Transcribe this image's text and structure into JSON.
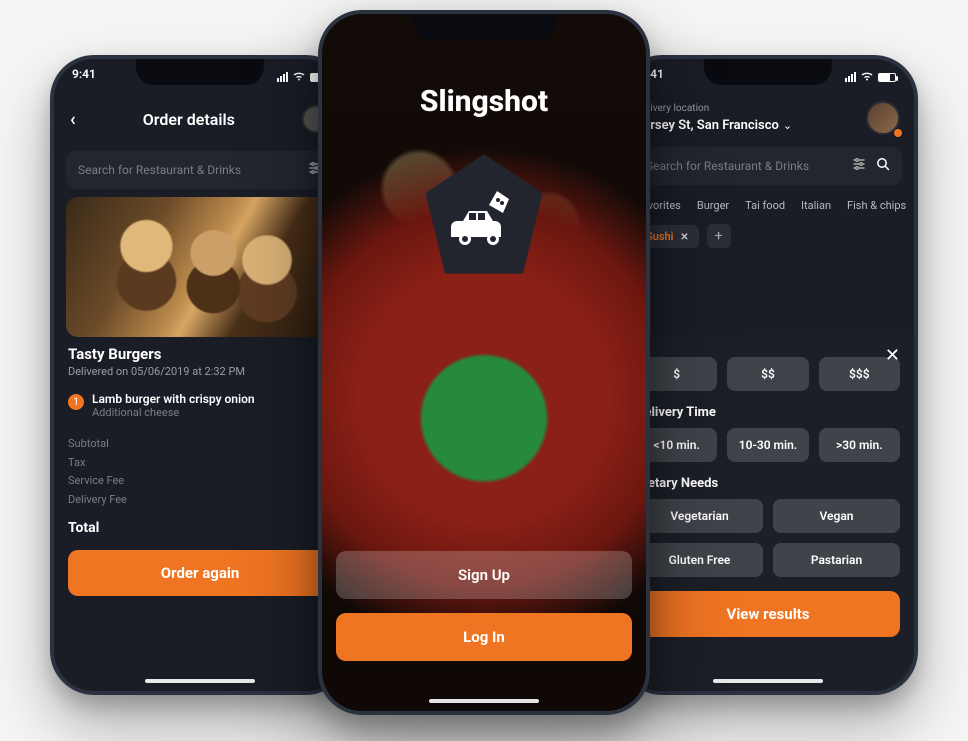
{
  "status": {
    "time": "9:41"
  },
  "left": {
    "title": "Order details",
    "search_placeholder": "Search for Restaurant & Drinks",
    "restaurant": "Tasty Burgers",
    "delivered": "Delivered on 05/06/2019 at 2:32 PM",
    "item_qty": "1",
    "item_name": "Lamb burger with crispy onion",
    "item_extra": "Additional cheese",
    "fees": {
      "subtotal": "Subtotal",
      "tax": "Tax",
      "service": "Service Fee",
      "delivery": "Delivery Fee"
    },
    "total_label": "Total",
    "total_value": "$",
    "cta": "Order again"
  },
  "center": {
    "brand": "Slingshot",
    "signup": "Sign Up",
    "login": "Log In"
  },
  "right": {
    "loc_label": "Delivery location",
    "loc_value": "Jersey St, San Francisco",
    "search_placeholder": "Search for Restaurant & Drinks",
    "categories": [
      "Favorites",
      "Burger",
      "Tai food",
      "Italian",
      "Fish & chips"
    ],
    "chip": "Sushi",
    "price": {
      "p1": "$",
      "p2": "$$",
      "p3": "$$$"
    },
    "time_h": "Delivery Time",
    "time": {
      "t1": "<10 min.",
      "t2": "10-30 min.",
      "t3": ">30 min."
    },
    "diet_h": "Dietary Needs",
    "diet": {
      "d1": "Vegetarian",
      "d2": "Vegan",
      "d3": "Gluten Free",
      "d4": "Pastarian"
    },
    "cta": "View results"
  }
}
